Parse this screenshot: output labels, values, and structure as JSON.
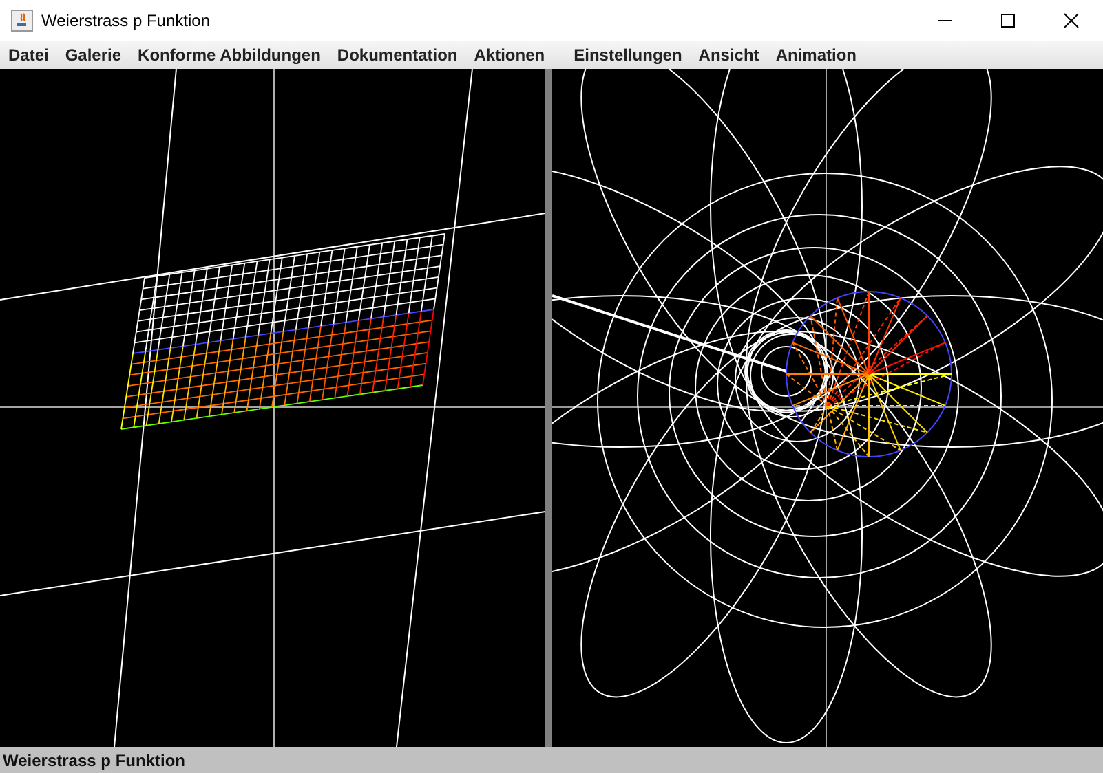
{
  "window": {
    "title": "Weierstrass p Funktion"
  },
  "menu": [
    "Datei",
    "Galerie",
    "Konforme Abbildungen",
    "Dokumentation",
    "Aktionen",
    "Einstellungen",
    "Ansicht",
    "Animation"
  ],
  "status_bar": {
    "text": "Weierstrass p Funktion"
  }
}
